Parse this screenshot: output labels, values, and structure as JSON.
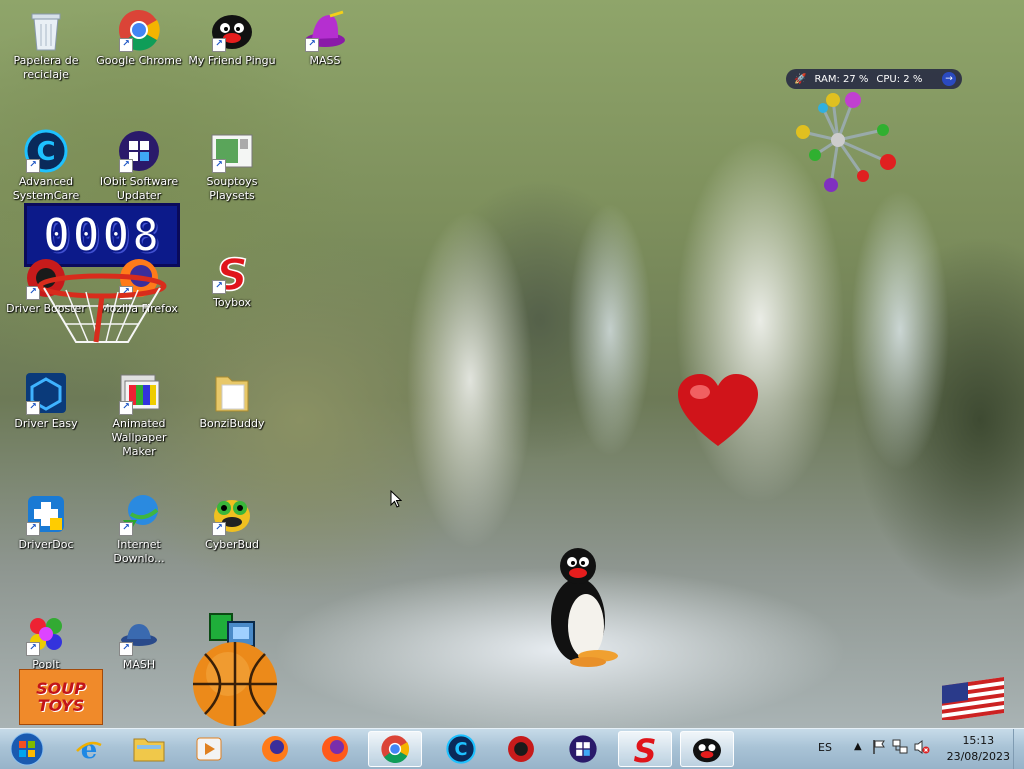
{
  "desktop": {
    "icons": [
      {
        "label": "Papelera de reciclaje",
        "icon": "recycle-bin-icon"
      },
      {
        "label": "Google Chrome",
        "icon": "chrome-icon"
      },
      {
        "label": "My Friend Pingu",
        "icon": "pingu-icon"
      },
      {
        "label": "MASS",
        "icon": "mass-hat-icon"
      },
      {
        "label": "Advanced SystemCare",
        "icon": "advanced-systemcare-icon"
      },
      {
        "label": "IObit Software Updater",
        "icon": "iobit-updater-icon"
      },
      {
        "label": "Souptoys Playsets",
        "icon": "souptoys-playsets-icon"
      },
      {
        "label": "Driver Booster",
        "icon": "driver-booster-icon"
      },
      {
        "label": "Mozilla Firefox",
        "icon": "firefox-icon"
      },
      {
        "label": "Toybox",
        "icon": "toybox-icon"
      },
      {
        "label": "Driver Easy",
        "icon": "driver-easy-icon"
      },
      {
        "label": "Animated Wallpaper Maker",
        "icon": "wallpaper-maker-icon"
      },
      {
        "label": "BonziBuddy",
        "icon": "folder-icon"
      },
      {
        "label": "DriverDoc",
        "icon": "driverdoc-icon"
      },
      {
        "label": "Internet Downlo...",
        "icon": "idm-icon"
      },
      {
        "label": "CyberBud",
        "icon": "cyberbud-icon"
      },
      {
        "label": "PopIt",
        "icon": "popit-icon"
      },
      {
        "label": "MASH",
        "icon": "mash-icon"
      }
    ],
    "counter_value": "0008",
    "ram_label": "RAM: 27 %",
    "cpu_label": "CPU: 2 %",
    "souptoys_logo": "SOUP TOYS"
  },
  "taskbar": {
    "buttons": [
      "start-orb",
      "internet-explorer",
      "file-explorer",
      "media-player",
      "firefox-1",
      "firefox-2",
      "chrome",
      "advanced-systemcare",
      "driver-booster",
      "iobit-updater",
      "toybox",
      "pingu"
    ],
    "active": [
      "chrome",
      "toybox",
      "pingu"
    ],
    "lang": "ES",
    "time": "15:13",
    "date": "23/08/2023"
  },
  "colors": {
    "taskbar": "#a9c3d6",
    "counter_bg": "#0c1a8a",
    "heart": "#d0141a"
  }
}
